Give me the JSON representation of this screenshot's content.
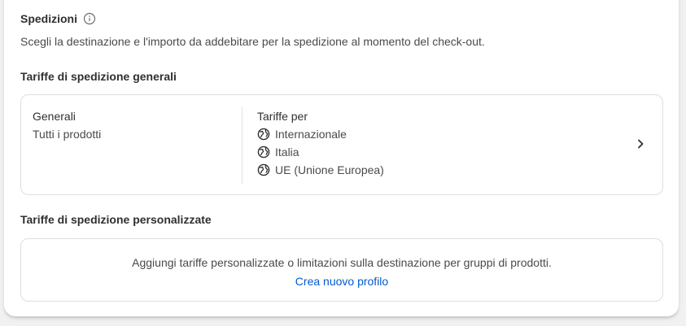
{
  "section": {
    "title": "Spedizioni",
    "subtitle": "Scegli la destinazione e l'importo da addebitare per la spedizione al momento del check-out."
  },
  "general_rates": {
    "heading": "Tariffe di spedizione generali",
    "profile_name": "Generali",
    "profile_desc": "Tutti i prodotti",
    "rates_label": "Tariffe per",
    "zones": [
      "Internazionale",
      "Italia",
      "UE (Unione Europea)"
    ]
  },
  "custom_rates": {
    "heading": "Tariffe di spedizione personalizzate",
    "description": "Aggiungi tariffe personalizzate o limitazioni sulla destinazione per gruppi di prodotti.",
    "link_label": "Crea nuovo profilo"
  },
  "colors": {
    "link": "#005bd3",
    "text": "#303030",
    "muted": "#4a4a4a",
    "border": "#dedede"
  },
  "icons": {
    "info": "info-icon",
    "zone": "globe-icon",
    "open": "chevron-right-icon"
  }
}
